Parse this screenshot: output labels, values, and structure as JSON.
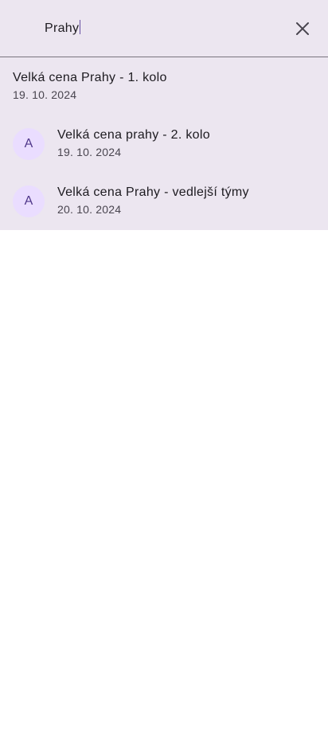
{
  "search": {
    "query": "Prahy",
    "clear_icon": "close-icon"
  },
  "results": [
    {
      "title": "Velká cena Prahy - 1. kolo",
      "date": "19. 10. 2024",
      "avatar": ""
    },
    {
      "title": "Velká cena prahy - 2. kolo",
      "date": "19. 10. 2024",
      "avatar": "A"
    },
    {
      "title": "Velká cena Prahy - vedlejší týmy",
      "date": "20. 10. 2024",
      "avatar": "A"
    }
  ],
  "colors": {
    "surface": "#ece6f0",
    "avatar_bg": "#eaddff",
    "avatar_fg": "#4f378a",
    "divider": "#79747e"
  }
}
